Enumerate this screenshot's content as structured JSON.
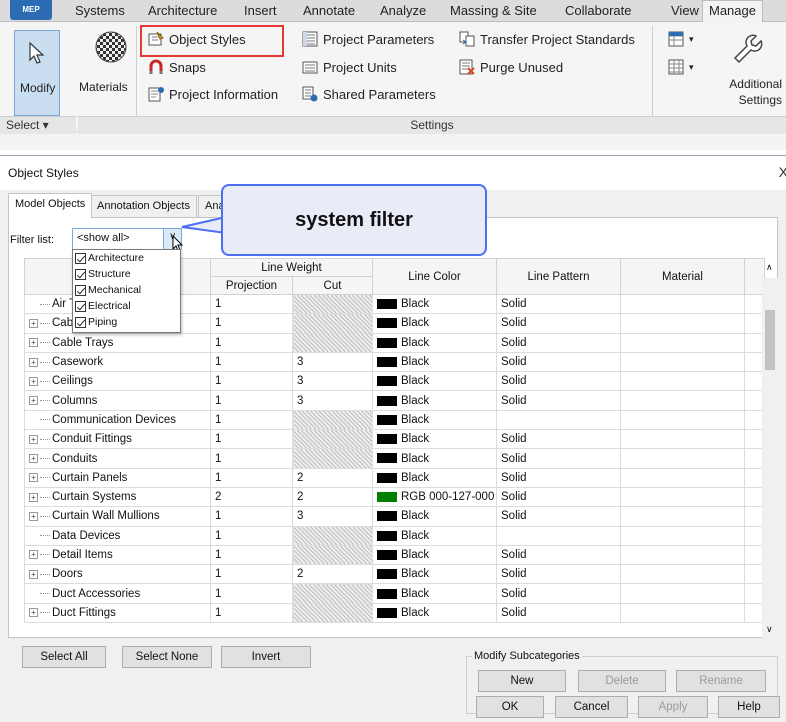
{
  "ribbon": {
    "app_badge": "MEP",
    "tabs": [
      "Systems",
      "Architecture",
      "Insert",
      "Annotate",
      "Analyze",
      "Massing & Site",
      "Collaborate",
      "View",
      "Manage"
    ],
    "active_tab": "Manage",
    "modify_label": "Modify",
    "materials_label": "Materials",
    "object_styles": "Object Styles",
    "snaps": "Snaps",
    "project_information": "Project Information",
    "project_parameters": "Project Parameters",
    "project_units": "Project Units",
    "shared_parameters": "Shared Parameters",
    "transfer_project_standards": "Transfer Project Standards",
    "purge_unused": "Purge Unused",
    "additional_settings": "Additional Settings",
    "select_panel": "Select ▾",
    "settings_panel": "Settings"
  },
  "dialog": {
    "title": "Object Styles",
    "close": "X",
    "tabs": [
      "Model Objects",
      "Annotation Objects",
      "Ana"
    ],
    "filter_label": "Filter list:",
    "filter_value": "<show all>",
    "filter_options": [
      "Architecture",
      "Structure",
      "Mechanical",
      "Electrical",
      "Piping"
    ],
    "callout": "system filter",
    "columns": {
      "category": "",
      "line_weight": "Line Weight",
      "projection": "Projection",
      "cut": "Cut",
      "line_color": "Line Color",
      "line_pattern": "Line Pattern",
      "material": "Material"
    },
    "rows": [
      {
        "name": "Air T",
        "expand": false,
        "projection": "1",
        "cut": "",
        "hatch": true,
        "color": "Black",
        "swatch": "#000000",
        "pattern": "Solid"
      },
      {
        "name": "Cab",
        "expand": true,
        "projection": "1",
        "cut": "",
        "hatch": true,
        "color": "Black",
        "swatch": "#000000",
        "pattern": "Solid"
      },
      {
        "name": "Cable Trays",
        "expand": true,
        "projection": "1",
        "cut": "",
        "hatch": true,
        "color": "Black",
        "swatch": "#000000",
        "pattern": "Solid"
      },
      {
        "name": "Casework",
        "expand": true,
        "projection": "1",
        "cut": "3",
        "hatch": false,
        "color": "Black",
        "swatch": "#000000",
        "pattern": "Solid"
      },
      {
        "name": "Ceilings",
        "expand": true,
        "projection": "1",
        "cut": "3",
        "hatch": false,
        "color": "Black",
        "swatch": "#000000",
        "pattern": "Solid"
      },
      {
        "name": "Columns",
        "expand": true,
        "projection": "1",
        "cut": "3",
        "hatch": false,
        "color": "Black",
        "swatch": "#000000",
        "pattern": "Solid"
      },
      {
        "name": "Communication Devices",
        "expand": false,
        "projection": "1",
        "cut": "",
        "hatch": true,
        "color": "Black",
        "swatch": "#000000",
        "pattern": ""
      },
      {
        "name": "Conduit Fittings",
        "expand": true,
        "projection": "1",
        "cut": "",
        "hatch": true,
        "color": "Black",
        "swatch": "#000000",
        "pattern": "Solid"
      },
      {
        "name": "Conduits",
        "expand": true,
        "projection": "1",
        "cut": "",
        "hatch": true,
        "color": "Black",
        "swatch": "#000000",
        "pattern": "Solid"
      },
      {
        "name": "Curtain Panels",
        "expand": true,
        "projection": "1",
        "cut": "2",
        "hatch": false,
        "color": "Black",
        "swatch": "#000000",
        "pattern": "Solid"
      },
      {
        "name": "Curtain Systems",
        "expand": true,
        "projection": "2",
        "cut": "2",
        "hatch": false,
        "color": "RGB 000-127-000",
        "swatch": "#007f00",
        "pattern": "Solid"
      },
      {
        "name": "Curtain Wall Mullions",
        "expand": true,
        "projection": "1",
        "cut": "3",
        "hatch": false,
        "color": "Black",
        "swatch": "#000000",
        "pattern": "Solid"
      },
      {
        "name": "Data Devices",
        "expand": false,
        "projection": "1",
        "cut": "",
        "hatch": true,
        "color": "Black",
        "swatch": "#000000",
        "pattern": ""
      },
      {
        "name": "Detail Items",
        "expand": true,
        "projection": "1",
        "cut": "",
        "hatch": true,
        "color": "Black",
        "swatch": "#000000",
        "pattern": "Solid"
      },
      {
        "name": "Doors",
        "expand": true,
        "projection": "1",
        "cut": "2",
        "hatch": false,
        "color": "Black",
        "swatch": "#000000",
        "pattern": "Solid"
      },
      {
        "name": "Duct Accessories",
        "expand": false,
        "projection": "1",
        "cut": "",
        "hatch": true,
        "color": "Black",
        "swatch": "#000000",
        "pattern": "Solid"
      },
      {
        "name": "Duct Fittings",
        "expand": true,
        "projection": "1",
        "cut": "",
        "hatch": true,
        "color": "Black",
        "swatch": "#000000",
        "pattern": "Solid"
      }
    ],
    "buttons": {
      "select_all": "Select All",
      "select_none": "Select None",
      "invert": "Invert",
      "modify_subcategories": "Modify Subcategories",
      "new": "New",
      "delete": "Delete",
      "rename": "Rename",
      "ok": "OK",
      "cancel": "Cancel",
      "apply": "Apply",
      "help": "Help"
    }
  }
}
